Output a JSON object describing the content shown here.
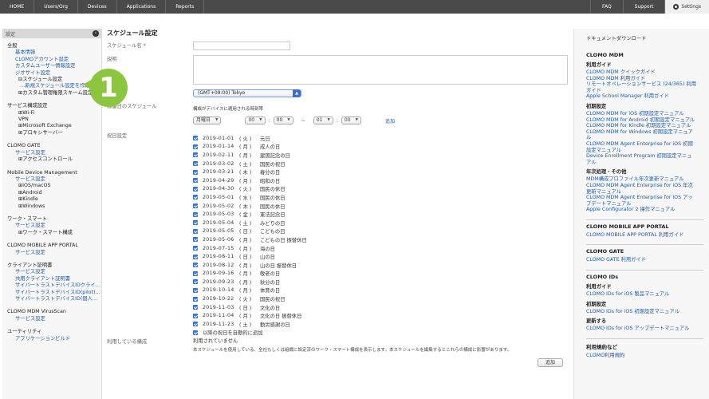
{
  "topbar": {
    "nav": [
      "HOME",
      "Users/Org",
      "Devices",
      "Applications",
      "Reports"
    ],
    "right": [
      "FAQ",
      "Support"
    ],
    "settings": "Settings"
  },
  "sidebar": {
    "header": "設定",
    "groups": [
      {
        "title": "全般",
        "items": [
          {
            "label": "基本情報",
            "type": "link"
          },
          {
            "label": "CLOMOアカウント設定",
            "type": "link"
          },
          {
            "label": "カスタムユーザー情報設定",
            "type": "link"
          },
          {
            "label": "ジオサイト設定",
            "type": "link"
          },
          {
            "label": "⊟スケジュール設定",
            "type": "node"
          },
          {
            "label": "…新規スケジュール設定を作成",
            "type": "link2"
          },
          {
            "label": "⊞カスタム管理権限スキーム設定",
            "type": "node"
          }
        ]
      },
      {
        "title": "サービス構成設定",
        "items": [
          {
            "label": "⊞Wi-Fi",
            "type": "node"
          },
          {
            "label": "VPN",
            "type": "node"
          },
          {
            "label": "⊞Microsoft Exchange",
            "type": "node"
          },
          {
            "label": "⊞プロキシサーバー",
            "type": "node"
          }
        ]
      },
      {
        "title": "CLOMO GATE",
        "items": [
          {
            "label": "サービス設定",
            "type": "link"
          },
          {
            "label": "⊞アクセスコントロール",
            "type": "node"
          }
        ]
      },
      {
        "title": "Mobile Device Management",
        "items": [
          {
            "label": "サービス設定",
            "type": "link"
          },
          {
            "label": "⊞iOS/macOS",
            "type": "node"
          },
          {
            "label": "⊞Android",
            "type": "node"
          },
          {
            "label": "⊞Kindle",
            "type": "node"
          },
          {
            "label": "⊞Windows",
            "type": "node"
          }
        ]
      },
      {
        "title": "ワーク・スマート",
        "items": [
          {
            "label": "サービス設定",
            "type": "link"
          },
          {
            "label": "⊞ワーク・スマート構成",
            "type": "node"
          }
        ]
      },
      {
        "title": "CLOMO MOBILE APP PORTAL",
        "items": [
          {
            "label": "サービス設定",
            "type": "link"
          }
        ]
      },
      {
        "title": "クライアント証明書",
        "items": [
          {
            "label": "サービス設定",
            "type": "link"
          },
          {
            "label": "共用クライアント証明書",
            "type": "link"
          },
          {
            "label": "サイバートラストデバイスIDクライ…",
            "type": "link"
          },
          {
            "label": "サイバートラストデバイスID(pilot)…",
            "type": "link"
          },
          {
            "label": "サイバートラストデバイスID(個人…",
            "type": "link"
          }
        ]
      },
      {
        "title": "CLOMO MDM VirusScan",
        "items": [
          {
            "label": "サービス設定",
            "type": "link"
          }
        ]
      },
      {
        "title": "ユーティリティ",
        "items": [
          {
            "label": "アプリケーションビルド",
            "type": "link"
          }
        ]
      }
    ]
  },
  "main": {
    "title": "スケジュール設定",
    "labels": {
      "name": "スケジュール名",
      "required": "*",
      "description": "説明",
      "timezone": "稼働日のスケジュール",
      "holidays": "祝日設定",
      "usage": "利用している構成"
    },
    "timezone_value": "(GMT+09:00) Tokyo",
    "timezone_note": "構成がデバイスに適用される時刻帯",
    "time": {
      "day": "月曜日",
      "start_h": "00",
      "start_m": "00",
      "sep": "~",
      "end_h": "01",
      "end_m": "00",
      "add": "追加"
    },
    "holidays": [
      {
        "date": "2019-01-01",
        "day": "( 火 )",
        "name": "元日"
      },
      {
        "date": "2019-01-14",
        "day": "( 月 )",
        "name": "成人の日"
      },
      {
        "date": "2019-02-11",
        "day": "( 月 )",
        "name": "建国記念の日"
      },
      {
        "date": "2019-03-02",
        "day": "( 土 )",
        "name": "国民の祝日"
      },
      {
        "date": "2019-03-21",
        "day": "( 木 )",
        "name": "春分の日"
      },
      {
        "date": "2019-04-29",
        "day": "( 月 )",
        "name": "昭和の日"
      },
      {
        "date": "2019-04-30",
        "day": "( 火 )",
        "name": "国民の休日"
      },
      {
        "date": "2019-05-01",
        "day": "( 水 )",
        "name": "国民の休日"
      },
      {
        "date": "2019-05-02",
        "day": "( 木 )",
        "name": "国民の休日"
      },
      {
        "date": "2019-05-03",
        "day": "( 金 )",
        "name": "憲法記念日"
      },
      {
        "date": "2019-05-04",
        "day": "( 土 )",
        "name": "みどりの日"
      },
      {
        "date": "2019-05-05",
        "day": "( 日 )",
        "name": "こどもの日"
      },
      {
        "date": "2019-05-06",
        "day": "( 月 )",
        "name": "こどもの日 振替休日"
      },
      {
        "date": "2019-07-15",
        "day": "( 月 )",
        "name": "海の日"
      },
      {
        "date": "2019-08-11",
        "day": "( 日 )",
        "name": "山の日"
      },
      {
        "date": "2019-08-12",
        "day": "( 月 )",
        "name": "山の日 振替休日"
      },
      {
        "date": "2019-09-16",
        "day": "( 月 )",
        "name": "敬老の日"
      },
      {
        "date": "2019-09-23",
        "day": "( 月 )",
        "name": "秋分の日"
      },
      {
        "date": "2019-10-14",
        "day": "( 月 )",
        "name": "体育の日"
      },
      {
        "date": "2019-10-22",
        "day": "( 火 )",
        "name": "国民の祝日"
      },
      {
        "date": "2019-11-03",
        "day": "( 日 )",
        "name": "文化の日"
      },
      {
        "date": "2019-11-04",
        "day": "( 月 )",
        "name": "文化の日 振替休日"
      },
      {
        "date": "2019-11-23",
        "day": "( 土 )",
        "name": "勤労感謝の日"
      }
    ],
    "auto_add": "以降の祝日を自動的に追加",
    "usage_value": "利用されていません",
    "usage_desc": "本スケジュールを使用している、全社もしくは組織に設定済のワーク・スマート構成を表示します。本スケジュールを編集するとこれらの構成に影響があります。",
    "submit": "追加",
    "callout": "1"
  },
  "docs": {
    "title": "ドキュメントダウンロード",
    "sections": [
      {
        "title": "CLOMO MDM",
        "subs": [
          {
            "title": "利用ガイド",
            "links": [
              "CLOMO MDM クイックガイド",
              "CLOMO MDM 利用ガイド",
              "リモートオペレーションサービス (24/365) 利用ガイド",
              "Apple School Manager 利用ガイド"
            ]
          },
          {
            "title": "初期設定",
            "links": [
              "CLOMO MDM for iOS 初期設定マニュアル",
              "CLOMO MDM for Android 初期設定マニュアル",
              "CLOMO MDM for Kindle 初期設定マニュアル",
              "CLOMO MDM for Windows 初期設定マニュアル",
              "CLOMO MDM Agent Enterprise for iOS 初期設定マニュアル",
              "Device Enrollment Program 初期設定マニュアル"
            ]
          },
          {
            "title": "年次処理・その他",
            "links": [
              "MDM構成プロファイル年次更新マニュアル",
              "CLOMO MDM Agent Enterprise for iOS 年次更新マニュアル",
              "CLOMO MDM Agent Enterprise for iOS アップデートマニュアル",
              "Apple Configurator 2 操作マニュアル"
            ]
          }
        ]
      },
      {
        "title": "CLOMO MOBILE APP PORTAL",
        "subs": [
          {
            "title": "",
            "links": [
              "CLOMO MOBILE APP PORTAL 利用ガイド"
            ]
          }
        ]
      },
      {
        "title": "CLOMO GATE",
        "subs": [
          {
            "title": "",
            "links": [
              "CLOMO GATE 利用ガイド"
            ]
          }
        ]
      },
      {
        "title": "CLOMO IDs",
        "subs": [
          {
            "title": "利用ガイド",
            "links": [
              "CLOMO IDs for iOS 製品マニュアル"
            ]
          },
          {
            "title": "初期設定",
            "links": [
              "CLOMO IDs for iOS 初期設定マニュアル"
            ]
          },
          {
            "title": "更新する",
            "links": [
              "CLOMO IDs for iOS アップデートマニュアル"
            ]
          }
        ]
      },
      {
        "title": "利用規約など",
        "subs": [
          {
            "title": "",
            "links": [
              "CLOMO利用規約"
            ]
          }
        ]
      }
    ]
  }
}
